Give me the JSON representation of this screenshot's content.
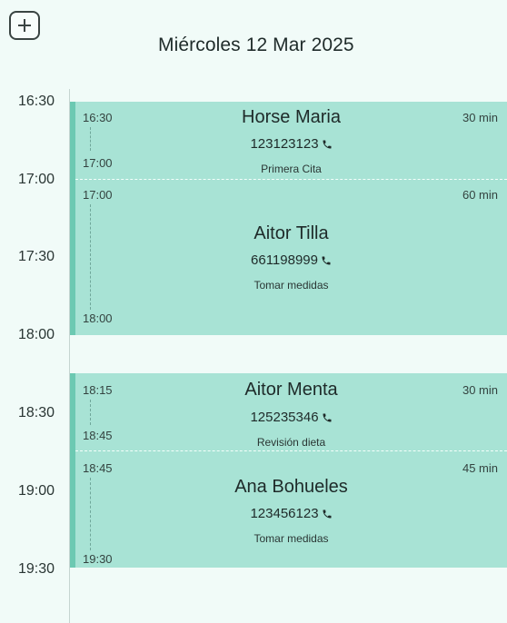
{
  "header": {
    "date_title": "Miércoles 12 Mar 2025"
  },
  "time_labels": [
    "16:30",
    "17:00",
    "17:30",
    "18:00",
    "18:30",
    "19:00",
    "19:30"
  ],
  "appointments": [
    {
      "start": "16:30",
      "end": "17:00",
      "duration": "30 min",
      "name": "Horse Maria",
      "phone": "123123123",
      "note": "Primera Cita"
    },
    {
      "start": "17:00",
      "end": "18:00",
      "duration": "60 min",
      "name": "Aitor Tilla",
      "phone": "661198999",
      "note": "Tomar medidas"
    },
    {
      "start": "18:15",
      "end": "18:45",
      "duration": "30 min",
      "name": "Aitor Menta",
      "phone": "125235346",
      "note": "Revisión dieta"
    },
    {
      "start": "18:45",
      "end": "19:30",
      "duration": "45 min",
      "name": "Ana Bohueles",
      "phone": "123456123",
      "note": "Tomar medidas"
    }
  ],
  "colors": {
    "block": "#a8e3d5",
    "accent": "#6cc9b2",
    "background": "#f1fbf8"
  },
  "icons": {
    "add": "plus-icon",
    "phone": "phone-icon"
  }
}
